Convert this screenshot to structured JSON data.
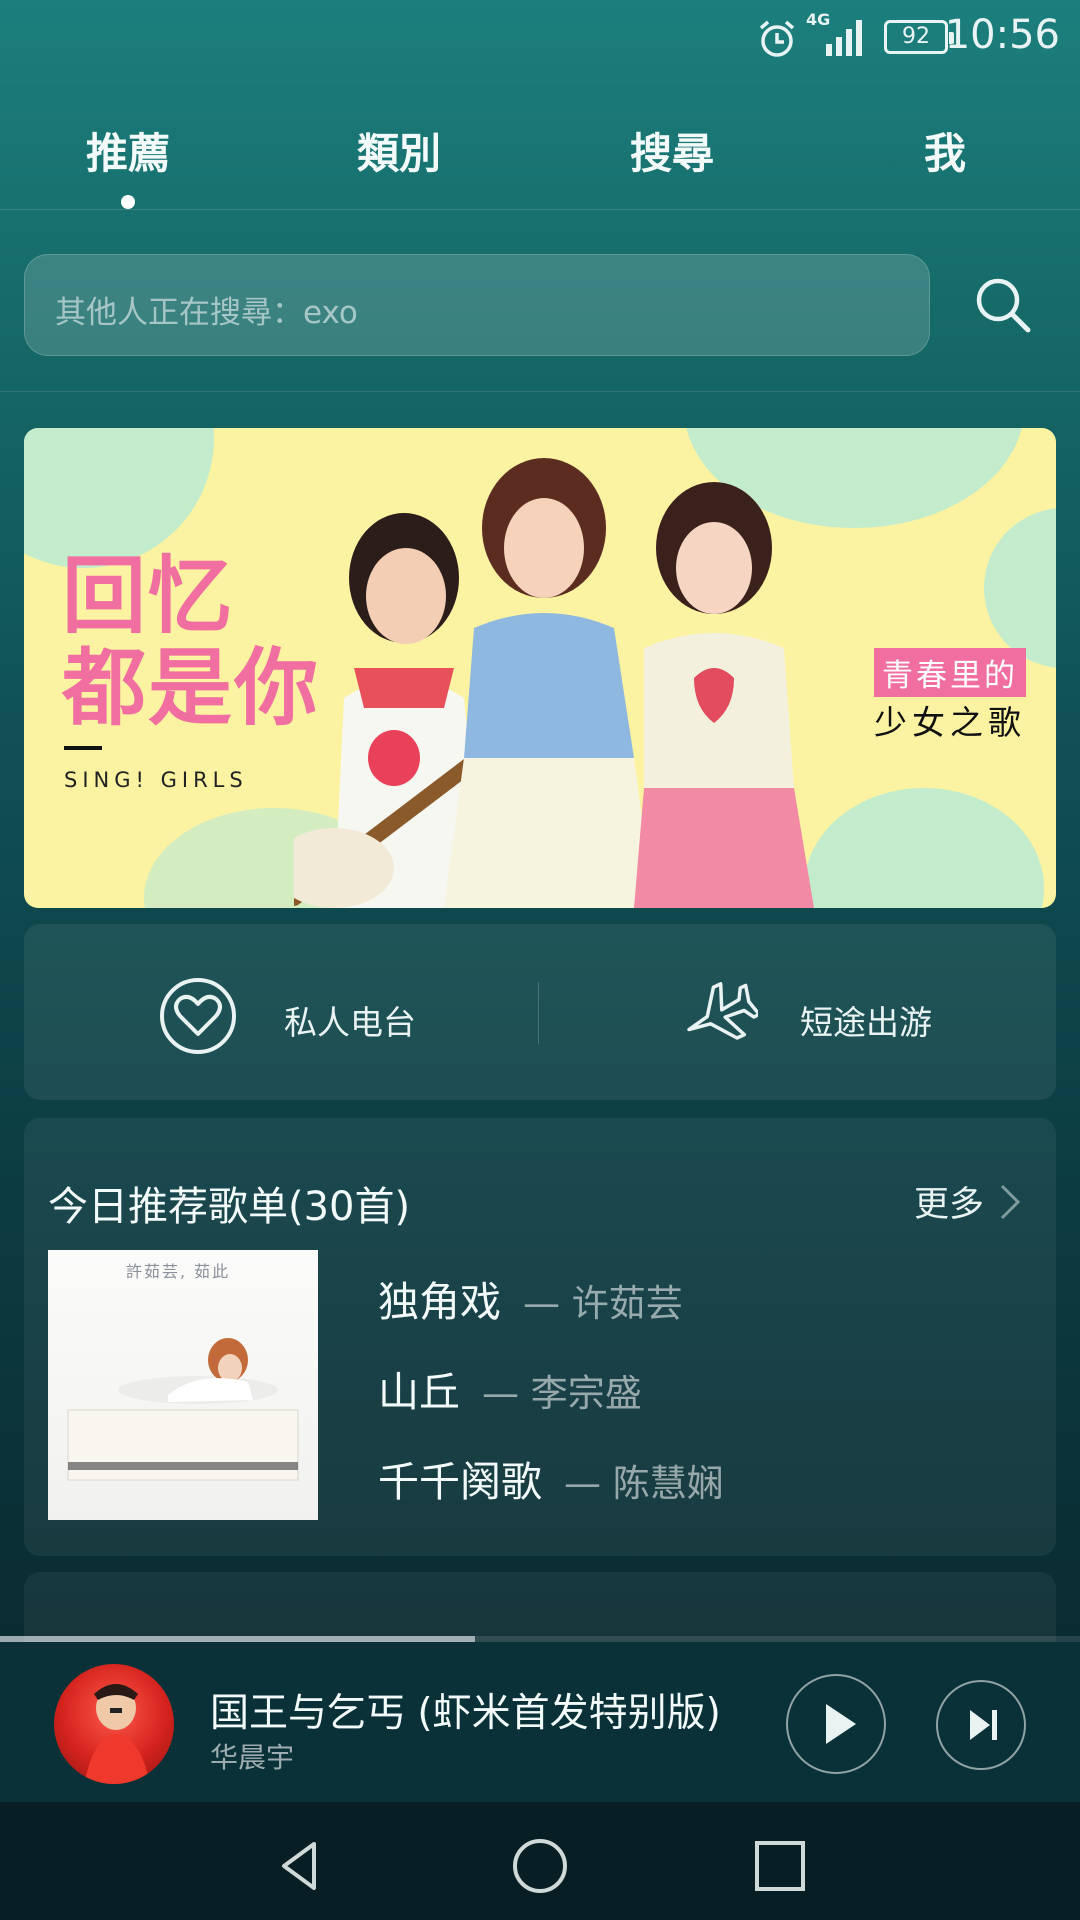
{
  "status_bar": {
    "network": "4G",
    "battery": "92",
    "time": "10:56"
  },
  "tabs": [
    {
      "label": "推薦",
      "active": true
    },
    {
      "label": "類別",
      "active": false
    },
    {
      "label": "搜尋",
      "active": false
    },
    {
      "label": "我",
      "active": false
    }
  ],
  "search": {
    "placeholder": "其他人正在搜尋：exo",
    "button_icon": "search-icon"
  },
  "banner": {
    "title_line1": "回忆",
    "title_line2": "都是你",
    "subtitle": "SING! GIRLS",
    "tag_line1": "青春里的",
    "tag_line2": "少女之歌",
    "colors": {
      "background": "#fbf3a2",
      "accent": "#f06ea0",
      "blob": "#b9ead5"
    }
  },
  "quick_actions": [
    {
      "label": "私人电台",
      "icon": "heart-icon"
    },
    {
      "label": "短途出游",
      "icon": "airplane-icon"
    }
  ],
  "recommended_playlist": {
    "heading": "今日推荐歌单(30首)",
    "more_label": "更多",
    "cover_text": "許茹芸, 茹此",
    "songs": [
      {
        "name": "独角戏",
        "artist": "— 许茹芸"
      },
      {
        "name": "山丘",
        "artist": "— 李宗盛"
      },
      {
        "name": "千千阕歌",
        "artist": "— 陈慧娴"
      }
    ]
  },
  "now_playing": {
    "title": "国王与乞丐 (虾米首发特别版)",
    "artist": "华晨宇",
    "progress": 0.44
  },
  "nav_bar": {
    "buttons": [
      "back-icon",
      "home-icon",
      "recents-icon"
    ]
  }
}
